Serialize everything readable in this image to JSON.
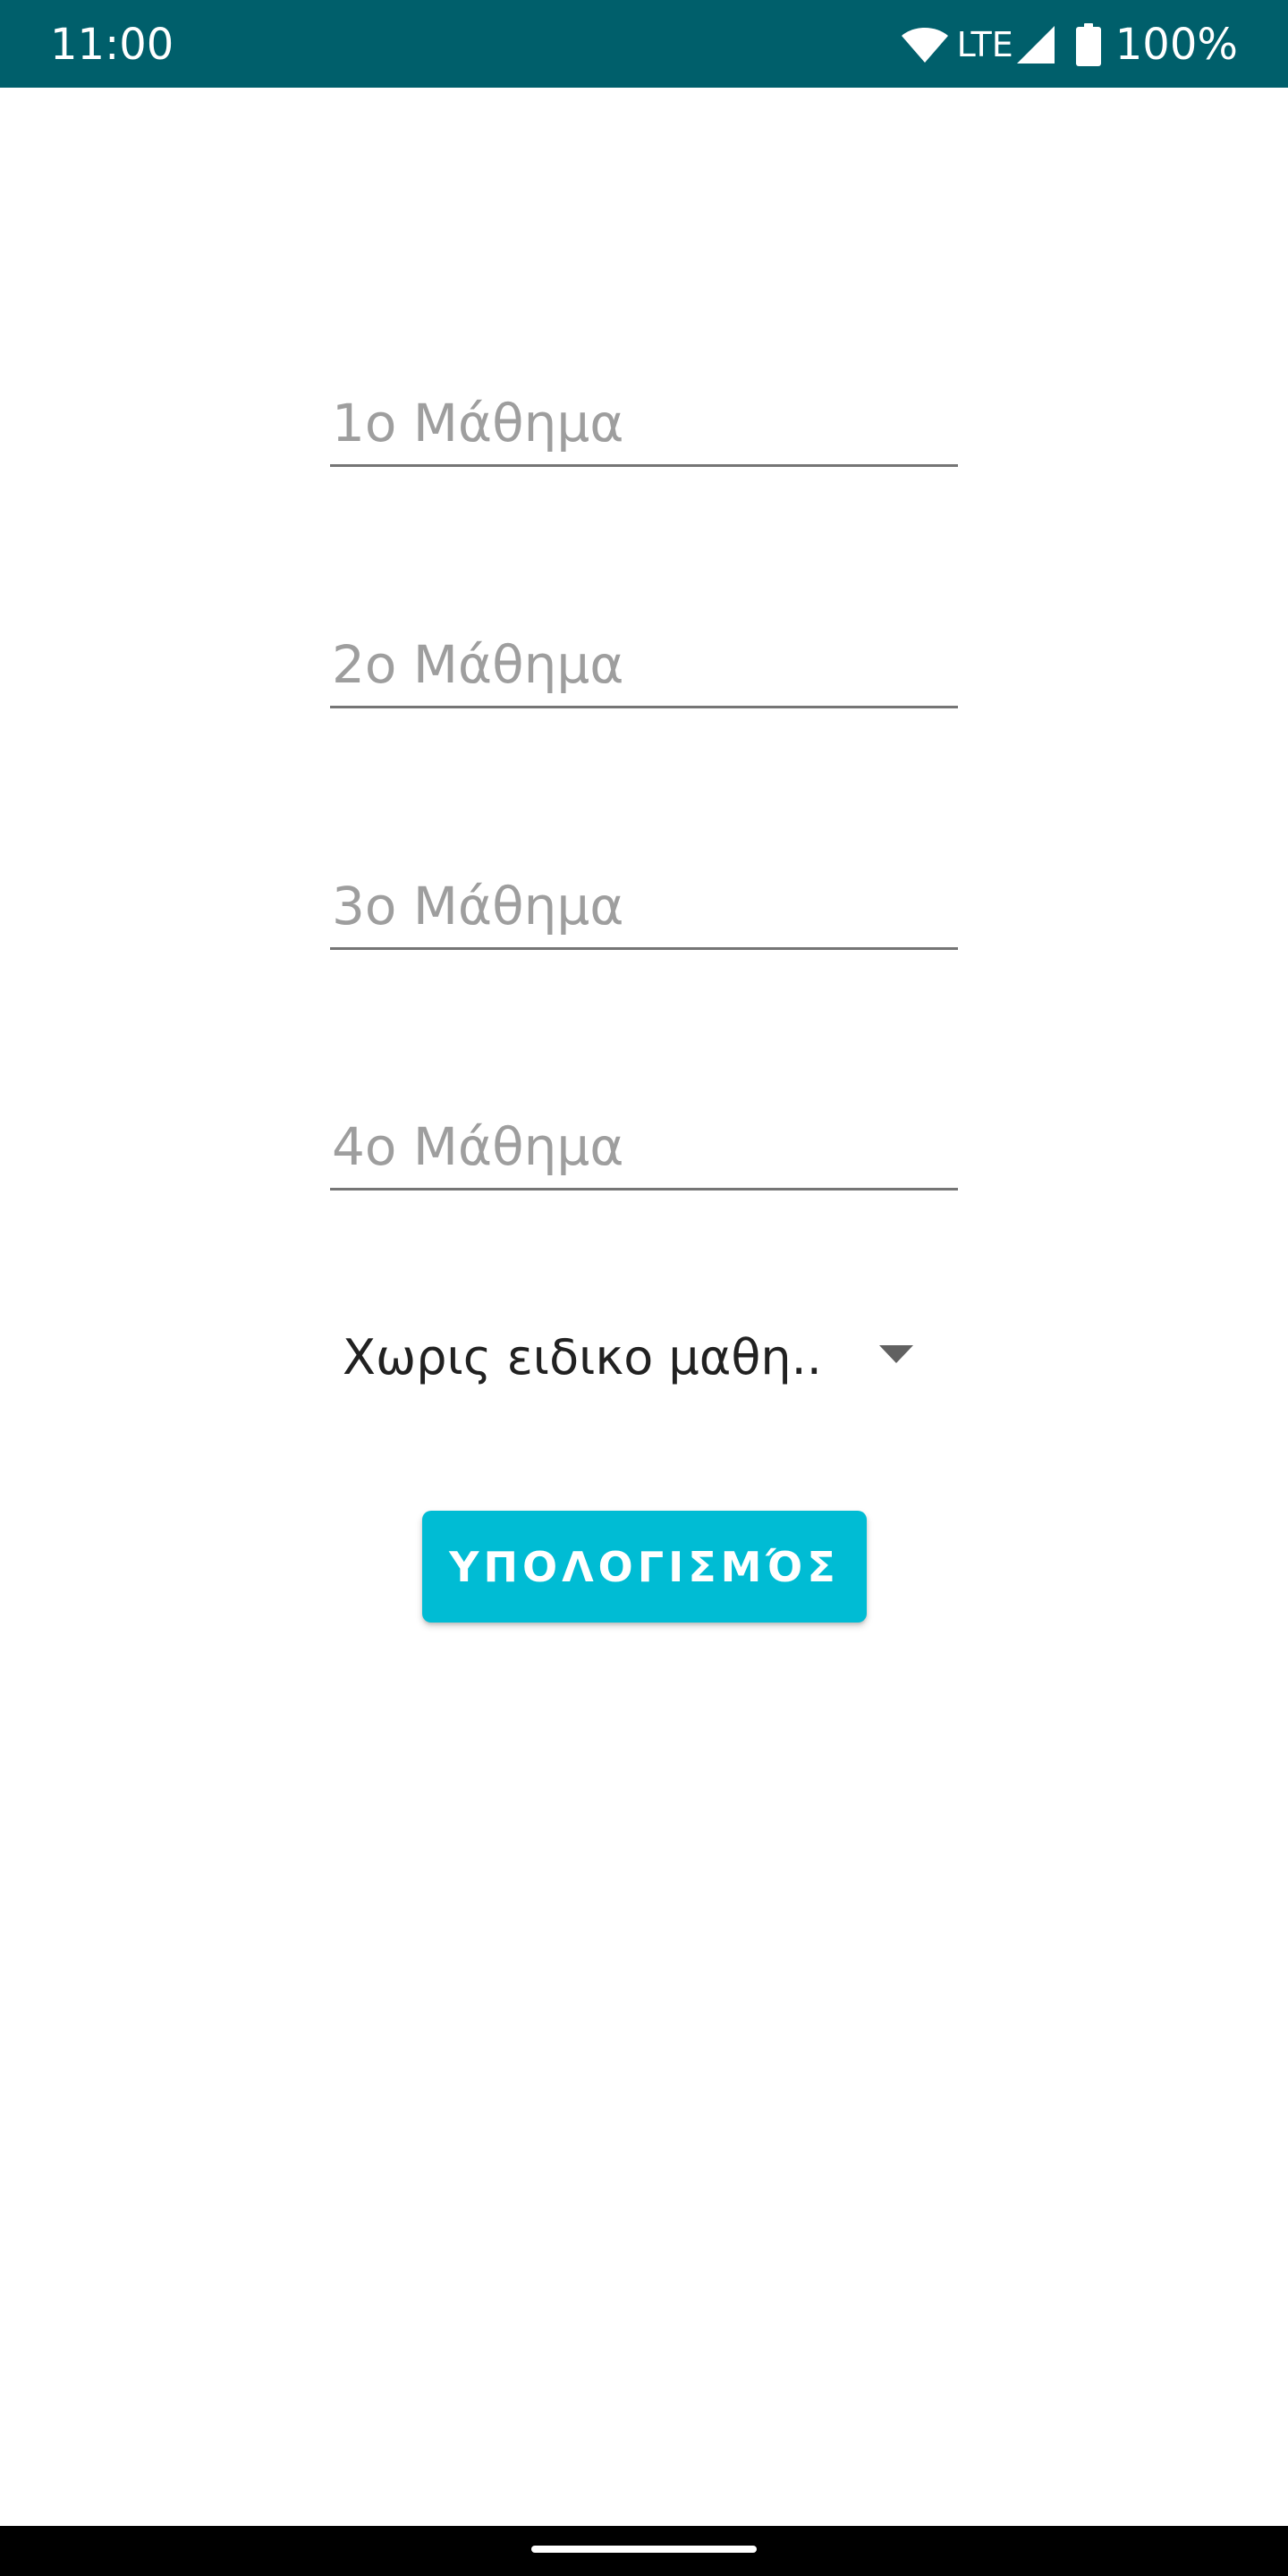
{
  "status_bar": {
    "time": "11:00",
    "network": "LTE",
    "battery": "100%",
    "icons": [
      "wifi-icon",
      "signal-icon",
      "battery-icon"
    ],
    "background_color": "#005f6b"
  },
  "form": {
    "fields": [
      {
        "placeholder": "1ο Μάθημα",
        "value": ""
      },
      {
        "placeholder": "2ο Μάθημα",
        "value": ""
      },
      {
        "placeholder": "3ο Μάθημα",
        "value": ""
      },
      {
        "placeholder": "4ο Μάθημα",
        "value": ""
      }
    ],
    "spinner": {
      "selected": "Χωρις ειδικο μαθη..",
      "icon": "dropdown-arrow-icon"
    },
    "calculate_button": {
      "label": "ΥΠΟΛΟΓΙΣΜΌΣ",
      "color": "#00bcd4"
    }
  },
  "nav_bar": {
    "background_color": "#000000"
  }
}
